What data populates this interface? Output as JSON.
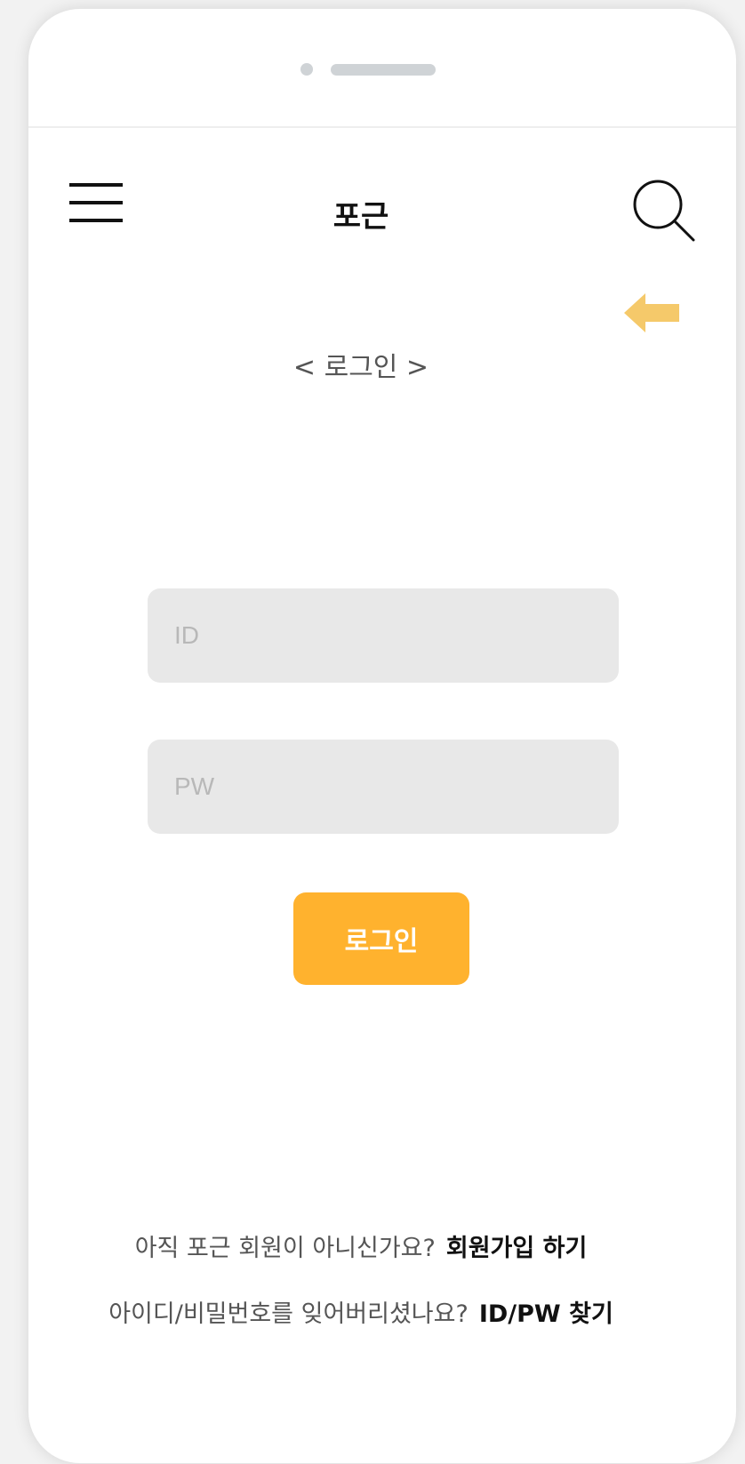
{
  "header": {
    "title": "포근",
    "icons": {
      "menu": "hamburger-menu-icon",
      "search": "search-icon",
      "back": "back-arrow-icon"
    }
  },
  "page": {
    "subtitle": "< 로그인 >"
  },
  "form": {
    "id_placeholder": "ID",
    "pw_placeholder": "PW",
    "login_label": "로그인"
  },
  "footer": {
    "signup_prompt": "아직 포근 회원이 아니신가요?",
    "signup_link": "회원가입 하기",
    "find_prompt": "아이디/비밀번호를 잊어버리셨나요?",
    "find_link": "ID/PW 찾기"
  },
  "colors": {
    "accent": "#ffb22e",
    "arrow": "#f5c96a",
    "field_bg": "#e8e8e8"
  }
}
